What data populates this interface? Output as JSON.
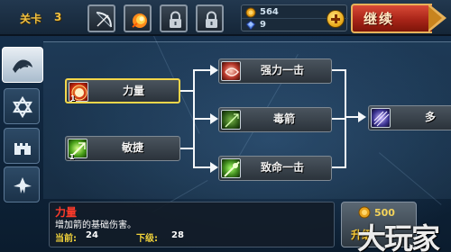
{
  "top_bar": {
    "level_label": "关卡",
    "level_number": "3",
    "equipment_slots": [
      {
        "icon": "bow-icon",
        "locked": false
      },
      {
        "icon": "fireball-icon",
        "locked": false
      },
      {
        "icon": "lock-icon",
        "locked": true
      },
      {
        "icon": "lock-icon",
        "locked": true
      }
    ],
    "gold": "564",
    "gems": "9",
    "continue_label": "继续"
  },
  "side_tabs": [
    {
      "icon": "bird-icon",
      "active": true
    },
    {
      "icon": "star-of-david-icon",
      "active": false
    },
    {
      "icon": "castle-icon",
      "active": false
    },
    {
      "icon": "eagle-icon",
      "active": false
    }
  ],
  "skill_tree": {
    "tier1": [
      {
        "name": "力量",
        "rank": "1",
        "selected": true,
        "icon": "power-fist-icon"
      },
      {
        "name": "敏捷",
        "rank": "1",
        "selected": false,
        "icon": "agility-icon"
      }
    ],
    "tier2": [
      {
        "name": "强力一击",
        "icon": "strong-strike-icon"
      },
      {
        "name": "毒箭",
        "icon": "poison-arrow-icon"
      },
      {
        "name": "致命一击",
        "icon": "critical-strike-icon"
      }
    ],
    "tier3": [
      {
        "name": "多",
        "icon": "multi-arrow-icon"
      }
    ]
  },
  "info_panel": {
    "title": "力量",
    "description": "增加箭的基础伤害。",
    "current_label": "当前:",
    "current_value": "24",
    "next_label": "下级:",
    "next_value": "28"
  },
  "upgrade_button": {
    "cost": "500",
    "label": "升级"
  },
  "watermark": "大玩家",
  "colors": {
    "gold_text": "#f0c040",
    "selected_border": "#f3d64a",
    "title_red": "#ff3b2a",
    "continue_red": "#a82418"
  }
}
